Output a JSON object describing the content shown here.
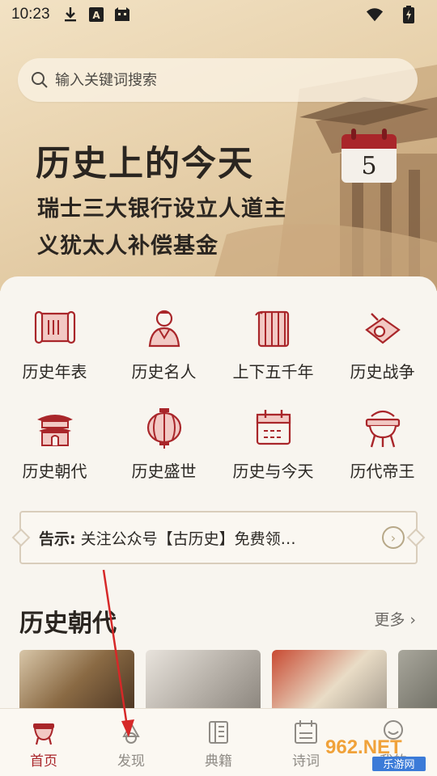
{
  "status_bar": {
    "time": "10:23",
    "icons": [
      "download-icon",
      "font-a-icon",
      "app-icon",
      "wifi-icon",
      "battery-charging-icon"
    ]
  },
  "search": {
    "placeholder": "输入关键词搜索",
    "icon": "search-icon"
  },
  "banner": {
    "title": "历史上的今天",
    "event": "瑞士三大银行设立人道主义犹太人补偿基金",
    "calendar_day": "5"
  },
  "categories": [
    {
      "label": "历史年表",
      "icon": "scroll-icon"
    },
    {
      "label": "历史名人",
      "icon": "person-icon"
    },
    {
      "label": "上下五千年",
      "icon": "bamboo-slip-icon"
    },
    {
      "label": "历史战争",
      "icon": "drum-icon"
    },
    {
      "label": "历史朝代",
      "icon": "palace-icon"
    },
    {
      "label": "历史盛世",
      "icon": "lantern-icon"
    },
    {
      "label": "历史与今天",
      "icon": "calendar-icon"
    },
    {
      "label": "历代帝王",
      "icon": "ding-cauldron-icon"
    }
  ],
  "notice": {
    "prefix": "告示:",
    "text": "关注公众号【古历史】免费领…"
  },
  "dynasty_section": {
    "title": "历史朝代",
    "more": "更多"
  },
  "thumbnails": [
    "dynasty-thumb-1",
    "dynasty-thumb-2",
    "dynasty-thumb-3",
    "dynasty-thumb-4"
  ],
  "bottom_nav": [
    {
      "label": "首页",
      "icon": "home-icon",
      "active": true
    },
    {
      "label": "发现",
      "icon": "discover-icon",
      "active": false
    },
    {
      "label": "典籍",
      "icon": "book-icon",
      "active": false
    },
    {
      "label": "诗词",
      "icon": "poem-icon",
      "active": false
    },
    {
      "label": "我的",
      "icon": "profile-icon",
      "active": false
    }
  ],
  "watermark": {
    "text": "962.NET",
    "subtext": "乐游网"
  },
  "colors": {
    "accent": "#a9262a",
    "background": "#f8f5ef",
    "banner": "#e8d2ad"
  }
}
